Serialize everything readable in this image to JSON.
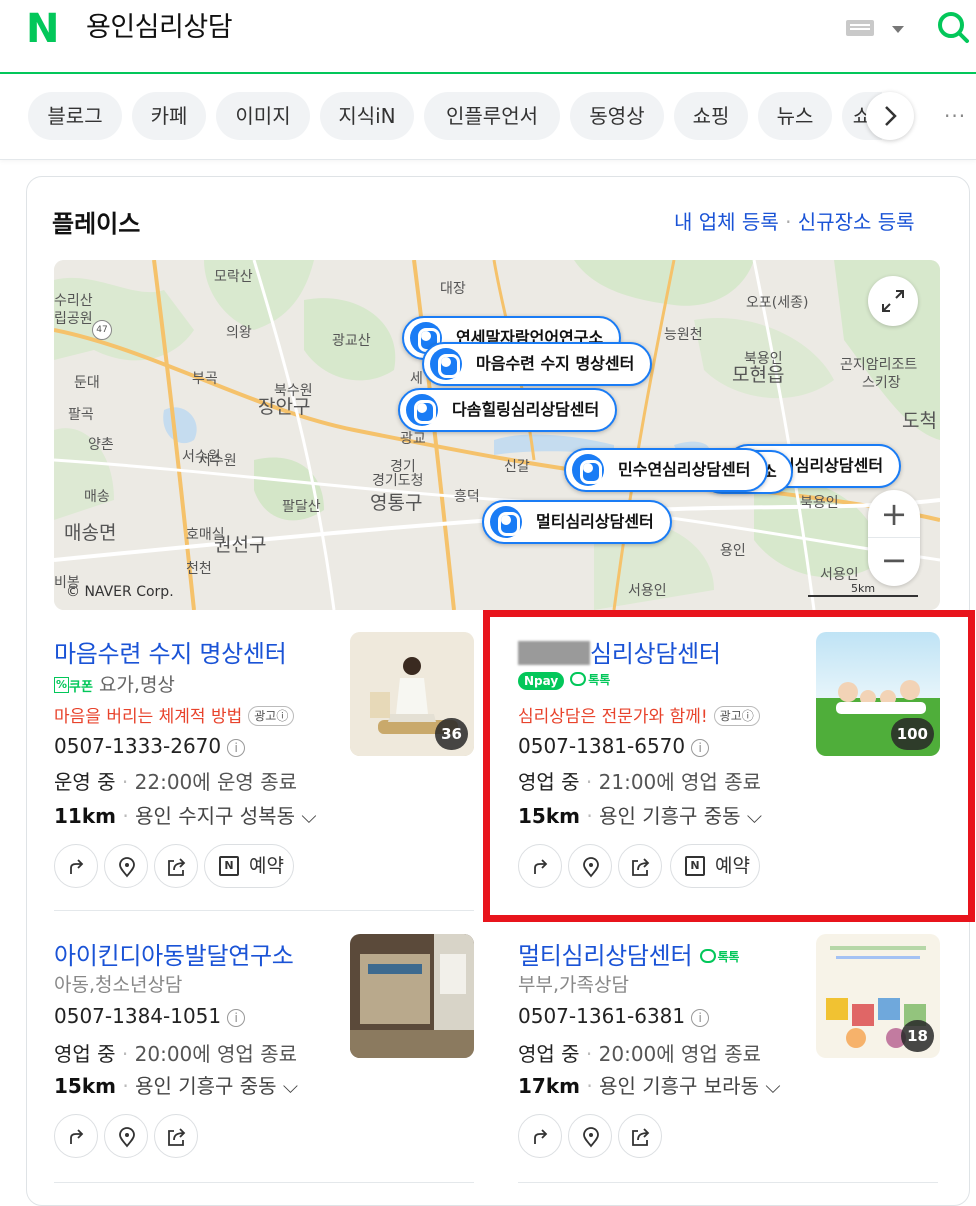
{
  "header": {
    "query": "용인심리상담",
    "logo": "N"
  },
  "tabs": [
    "블로그",
    "카페",
    "이미지",
    "지식iN",
    "인플루언서",
    "동영상",
    "쇼핑",
    "뉴스",
    "쇼"
  ],
  "place": {
    "title": "플레이스",
    "register_my": "내 업체 등록",
    "register_new": "신규장소 등록"
  },
  "map": {
    "copyright": "© NAVER Corp.",
    "scale": "5km",
    "pins": [
      "연세말자람언어연구소",
      "마음수련 수지 명상센터",
      "다솜힐링심리상담센터",
      "민수연심리상담센터",
      "이심리상담센터",
      "소",
      "멀티심리상담센터"
    ],
    "labels": [
      "모락산",
      "수리산",
      "립공원",
      "의왕",
      "광교산",
      "부곡",
      "둔대",
      "팔곡",
      "양촌",
      "서수원",
      "매송",
      "매송면",
      "호매실",
      "권선구",
      "천천",
      "비봉",
      "장안구",
      "북수원",
      "팔달산",
      "경기도청",
      "영통구",
      "흥덕",
      "신갈",
      "대장",
      "오포(세종)",
      "능원천",
      "북용인",
      "모현읍",
      "곤지암리조트",
      "스키장",
      "도척",
      "북용인",
      "용인",
      "서용인",
      "서용인",
      "경기",
      "광교",
      "서수원",
      "세"
    ]
  },
  "listings": [
    {
      "name": "마음수련 수지 명상센터",
      "coupon": "쿠폰",
      "category": "요가,명상",
      "promo": "마음을 버리는 체계적 방법",
      "ad": "광고ⓘ",
      "phone": "0507-1333-2670",
      "status": "운영 중",
      "close": "22:00에 운영 종료",
      "distance": "11km",
      "address": "용인 수지구 성복동",
      "photos": "36",
      "reserve": "예약"
    },
    {
      "name_visible": "심리상담센터",
      "npay": "Npay",
      "talk": "톡톡",
      "promo": "심리상담은 전문가와 함께!",
      "ad": "광고ⓘ",
      "phone": "0507-1381-6570",
      "status": "영업 중",
      "close": "21:00에 영업 종료",
      "distance": "15km",
      "address": "용인 기흥구 중동",
      "photos": "100",
      "reserve": "예약"
    },
    {
      "name": "아이킨디아동발달연구소",
      "category": "아동,청소년상담",
      "phone": "0507-1384-1051",
      "status": "영업 중",
      "close": "20:00에 영업 종료",
      "distance": "15km",
      "address": "용인 기흥구 중동"
    },
    {
      "name": "멀티심리상담센터",
      "talk": "톡톡",
      "category": "부부,가족상담",
      "phone": "0507-1361-6381",
      "status": "영업 중",
      "close": "20:00에 영업 종료",
      "distance": "17km",
      "address": "용인 기흥구 보라동",
      "photos": "18"
    }
  ],
  "colors": {
    "brand": "#03c75a",
    "link": "#1a53d6",
    "promo": "#e8432c",
    "pin": "#1a7cf5",
    "highlight": "#e8141c"
  },
  "icons": [
    "search-icon",
    "keyboard-icon",
    "chevron-right-icon",
    "expand-icon",
    "directions-icon",
    "location-icon",
    "share-icon",
    "calendar-icon"
  ]
}
